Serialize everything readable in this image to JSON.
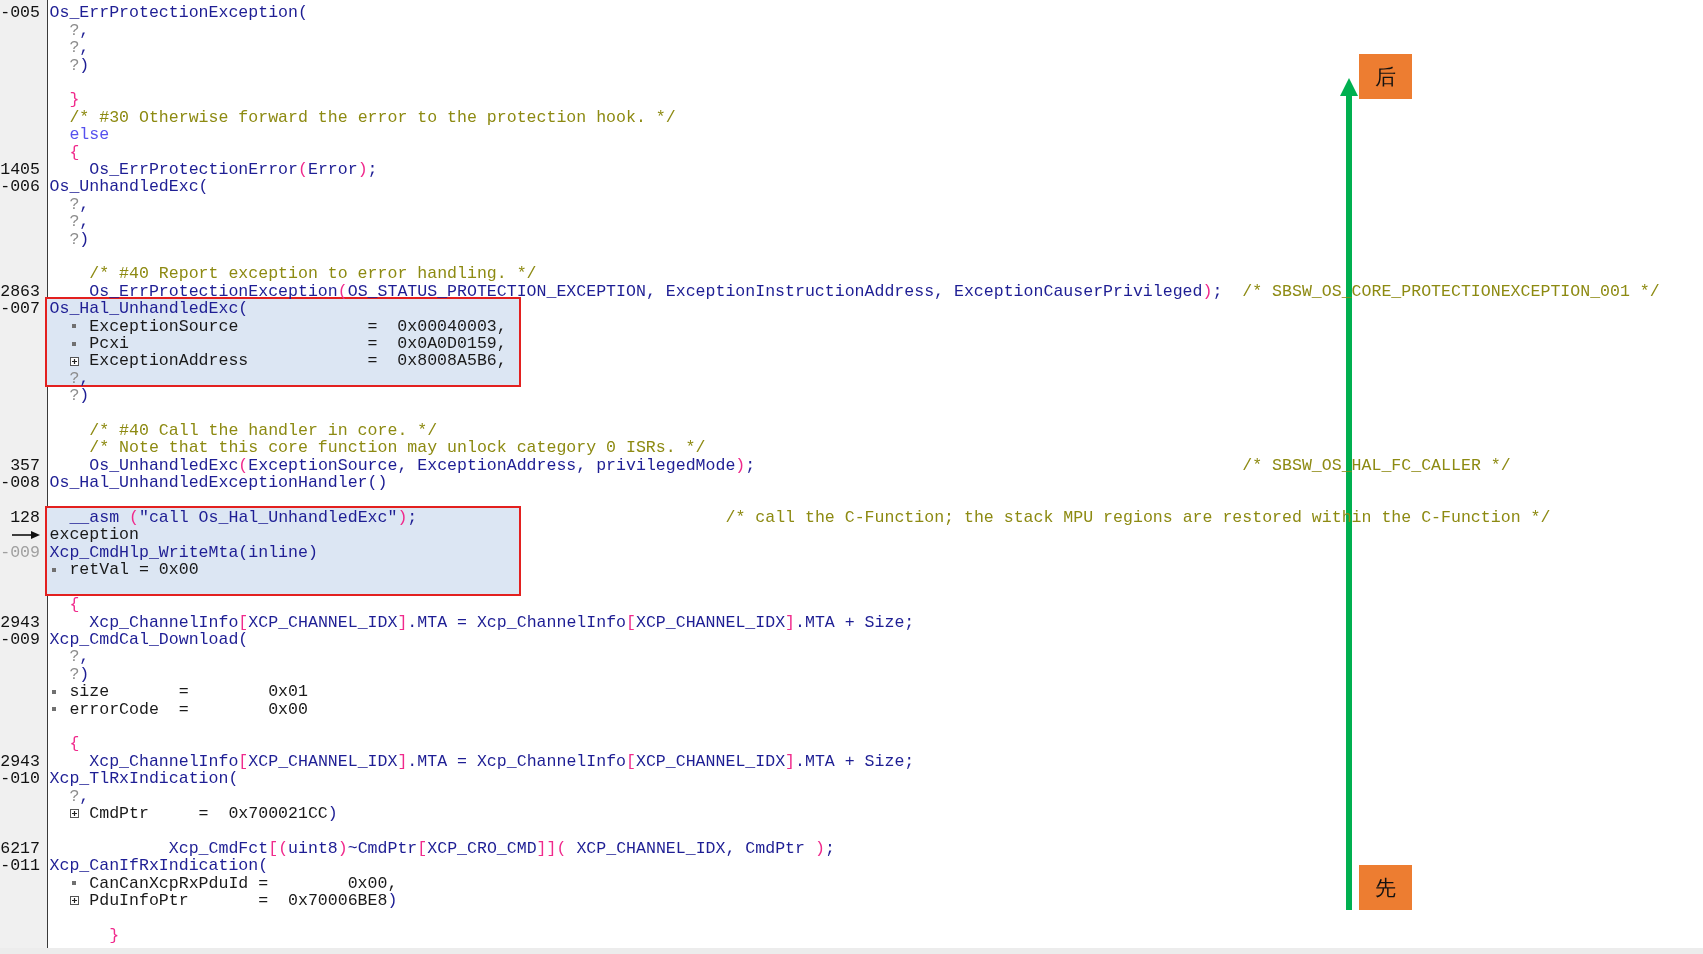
{
  "lines": [
    {
      "kind": "frame",
      "boxed": false,
      "current": false,
      "number": {
        "text": "-005",
        "dimmed": false
      },
      "parts": [
        {
          "kind": "frame",
          "tokens": [
            {
              "kind": "name",
              "text": "Os_ErrProtectionException("
            }
          ]
        }
      ]
    },
    {
      "kind": "arg",
      "boxed": false,
      "current": false,
      "parts": [
        {
          "kind": "argument",
          "tokens": [
            {
              "kind": "unknown",
              "text": "?"
            },
            {
              "kind": "name",
              "text": ","
            }
          ]
        }
      ]
    },
    {
      "kind": "arg",
      "boxed": false,
      "current": false,
      "parts": [
        {
          "kind": "argument",
          "tokens": [
            {
              "kind": "unknown",
              "text": "?"
            },
            {
              "kind": "name",
              "text": ","
            }
          ]
        }
      ]
    },
    {
      "kind": "arg",
      "boxed": false,
      "current": false,
      "parts": [
        {
          "kind": "argument",
          "tokens": [
            {
              "kind": "unknown",
              "text": "?"
            },
            {
              "kind": "name",
              "text": ")"
            }
          ]
        }
      ]
    },
    {
      "kind": "blank",
      "boxed": false,
      "current": false
    },
    {
      "kind": "code",
      "boxed": false,
      "current": false,
      "parts": [
        {
          "kind": "source",
          "tokens": [
            {
              "kind": "punct",
              "text": "  }"
            }
          ]
        }
      ]
    },
    {
      "kind": "code",
      "boxed": false,
      "current": false,
      "parts": [
        {
          "kind": "comment",
          "tokens": [
            {
              "kind": "comment",
              "text": "  /* #30 Otherwise forward the error to the protection hook. */"
            }
          ]
        }
      ]
    },
    {
      "kind": "code",
      "boxed": false,
      "current": false,
      "parts": [
        {
          "kind": "source",
          "tokens": [
            {
              "kind": "keyword",
              "text": "  else"
            }
          ]
        }
      ]
    },
    {
      "kind": "code",
      "boxed": false,
      "current": false,
      "parts": [
        {
          "kind": "source",
          "tokens": [
            {
              "kind": "punct",
              "text": "  {"
            }
          ]
        }
      ]
    },
    {
      "kind": "code",
      "boxed": false,
      "current": false,
      "number": {
        "text": "1405",
        "dimmed": false
      },
      "parts": [
        {
          "kind": "source",
          "tokens": [
            {
              "kind": "name",
              "text": "    Os_ErrProtectionError"
            },
            {
              "kind": "punct",
              "text": "("
            },
            {
              "kind": "name",
              "text": "Error"
            },
            {
              "kind": "punct",
              "text": ")"
            },
            {
              "kind": "name",
              "text": ";"
            }
          ]
        }
      ]
    },
    {
      "kind": "frame",
      "boxed": false,
      "current": false,
      "number": {
        "text": "-006",
        "dimmed": false
      },
      "parts": [
        {
          "kind": "frame",
          "tokens": [
            {
              "kind": "name",
              "text": "Os_UnhandledExc("
            }
          ]
        }
      ]
    },
    {
      "kind": "arg",
      "boxed": false,
      "current": false,
      "parts": [
        {
          "kind": "argument",
          "tokens": [
            {
              "kind": "unknown",
              "text": "?"
            },
            {
              "kind": "name",
              "text": ","
            }
          ]
        }
      ]
    },
    {
      "kind": "arg",
      "boxed": false,
      "current": false,
      "parts": [
        {
          "kind": "argument",
          "tokens": [
            {
              "kind": "unknown",
              "text": "?"
            },
            {
              "kind": "name",
              "text": ","
            }
          ]
        }
      ]
    },
    {
      "kind": "arg",
      "boxed": false,
      "current": false,
      "parts": [
        {
          "kind": "argument",
          "tokens": [
            {
              "kind": "unknown",
              "text": "?"
            },
            {
              "kind": "name",
              "text": ")"
            }
          ]
        }
      ]
    },
    {
      "kind": "blank",
      "boxed": false,
      "current": false
    },
    {
      "kind": "code",
      "boxed": false,
      "current": false,
      "parts": [
        {
          "kind": "comment",
          "tokens": [
            {
              "kind": "comment",
              "text": "    /* #40 Report exception to error handling. */"
            }
          ]
        }
      ]
    },
    {
      "kind": "code",
      "boxed": false,
      "current": false,
      "number": {
        "text": "2863",
        "dimmed": false
      },
      "parts": [
        {
          "kind": "source",
          "tokens": [
            {
              "kind": "name",
              "text": "    Os_ErrProtectionException"
            },
            {
              "kind": "punct",
              "text": "("
            },
            {
              "kind": "name",
              "text": "OS_STATUS_PROTECTION_EXCEPTION, ExceptionInstructionAddress, ExceptionCauserPrivileged"
            },
            {
              "kind": "punct",
              "text": ")"
            },
            {
              "kind": "name",
              "text": ";"
            }
          ]
        },
        {
          "kind": "comment",
          "tokens": [
            {
              "kind": "comment",
              "text": "  /* SBSW_OS_CORE_PROTECTIONEXCEPTION_001 */"
            }
          ]
        }
      ]
    },
    {
      "kind": "frame",
      "boxed": true,
      "current": false,
      "number": {
        "text": "-007",
        "dimmed": false
      },
      "parts": [
        {
          "kind": "frame",
          "tokens": [
            {
              "kind": "name",
              "text": "Os_Hal_UnhandledExc("
            }
          ]
        }
      ]
    },
    {
      "kind": "arg",
      "boxed": true,
      "current": false,
      "parts": [
        {
          "kind": "bullet"
        },
        {
          "kind": "argument",
          "tokens": [
            {
              "kind": "plain",
              "text": "ExceptionSource             =  0x00040003,"
            }
          ]
        }
      ]
    },
    {
      "kind": "arg",
      "boxed": true,
      "current": false,
      "parts": [
        {
          "kind": "bullet"
        },
        {
          "kind": "argument",
          "tokens": [
            {
              "kind": "plain",
              "text": "Pcxi                        =  0x0A0D0159,"
            }
          ]
        }
      ]
    },
    {
      "kind": "arg",
      "boxed": true,
      "current": false,
      "parts": [
        {
          "kind": "expand"
        },
        {
          "kind": "argument",
          "tokens": [
            {
              "kind": "plain",
              "text": "ExceptionAddress            =  0x8008A5B6,"
            }
          ]
        }
      ]
    },
    {
      "kind": "arg",
      "boxed": true,
      "current": false,
      "parts": [
        {
          "kind": "argument",
          "tokens": [
            {
              "kind": "unknown",
              "text": "?"
            },
            {
              "kind": "name",
              "text": ","
            }
          ]
        }
      ]
    },
    {
      "kind": "arg",
      "boxed": false,
      "current": false,
      "parts": [
        {
          "kind": "argument",
          "tokens": [
            {
              "kind": "unknown",
              "text": "?"
            },
            {
              "kind": "name",
              "text": ")"
            }
          ]
        }
      ]
    },
    {
      "kind": "blank",
      "boxed": false,
      "current": false
    },
    {
      "kind": "code",
      "boxed": false,
      "current": false,
      "parts": [
        {
          "kind": "comment",
          "tokens": [
            {
              "kind": "comment",
              "text": "    /* #40 Call the handler in core. */"
            }
          ]
        }
      ]
    },
    {
      "kind": "code",
      "boxed": false,
      "current": false,
      "parts": [
        {
          "kind": "comment",
          "tokens": [
            {
              "kind": "comment",
              "text": "    /* Note that this core function may unlock category 0 ISRs. */"
            }
          ]
        }
      ]
    },
    {
      "kind": "code",
      "boxed": false,
      "current": false,
      "number": {
        "text": "357",
        "dimmed": false
      },
      "parts": [
        {
          "kind": "source",
          "tokens": [
            {
              "kind": "name",
              "text": "    Os_UnhandledExc"
            },
            {
              "kind": "punct",
              "text": "("
            },
            {
              "kind": "name",
              "text": "ExceptionSource, ExceptionAddress, privilegedMode"
            },
            {
              "kind": "punct",
              "text": ")"
            },
            {
              "kind": "name",
              "text": ";"
            }
          ]
        },
        {
          "kind": "comment",
          "tokens": [
            {
              "kind": "comment",
              "text": "                                                 /* SBSW_OS_HAL_FC_CALLER */"
            }
          ]
        }
      ]
    },
    {
      "kind": "frame",
      "boxed": false,
      "current": false,
      "number": {
        "text": "-008",
        "dimmed": false
      },
      "parts": [
        {
          "kind": "frame",
          "tokens": [
            {
              "kind": "name",
              "text": "Os_Hal_UnhandledExceptionHandler()"
            }
          ]
        }
      ]
    },
    {
      "kind": "blank",
      "boxed": false,
      "current": false
    },
    {
      "kind": "code",
      "boxed": true,
      "current": false,
      "number": {
        "text": "128",
        "dimmed": false
      },
      "parts": [
        {
          "kind": "source",
          "tokens": [
            {
              "kind": "name",
              "text": "  __asm "
            },
            {
              "kind": "punct",
              "text": "("
            },
            {
              "kind": "name",
              "text": "\"call Os_Hal_UnhandledExc\""
            },
            {
              "kind": "punct",
              "text": ")"
            },
            {
              "kind": "name",
              "text": ";"
            }
          ]
        },
        {
          "kind": "comment",
          "tokens": [
            {
              "kind": "comment",
              "text": "                               /* call the C-Function; the stack MPU regions are restored within the C-Function */"
            }
          ]
        }
      ]
    },
    {
      "kind": "frame",
      "boxed": true,
      "current": true,
      "parts": [
        {
          "kind": "frame",
          "tokens": [
            {
              "kind": "plain",
              "text": "exception"
            }
          ]
        }
      ]
    },
    {
      "kind": "frame",
      "boxed": true,
      "current": false,
      "number": {
        "text": "-009",
        "dimmed": true
      },
      "parts": [
        {
          "kind": "frame",
          "tokens": [
            {
              "kind": "name",
              "text": "Xcp_CmdHlp_WriteMta(inline)"
            }
          ]
        }
      ]
    },
    {
      "kind": "local",
      "boxed": true,
      "current": false,
      "parts": [
        {
          "kind": "bullet"
        },
        {
          "kind": "local",
          "tokens": [
            {
              "kind": "plain",
              "text": "retVal = 0x00"
            }
          ]
        }
      ]
    },
    {
      "kind": "blank",
      "boxed": true,
      "current": false
    },
    {
      "kind": "code",
      "boxed": false,
      "current": false,
      "parts": [
        {
          "kind": "source",
          "tokens": [
            {
              "kind": "punct",
              "text": "  {"
            }
          ]
        }
      ]
    },
    {
      "kind": "code",
      "boxed": false,
      "current": false,
      "number": {
        "text": "2943",
        "dimmed": false
      },
      "parts": [
        {
          "kind": "source",
          "tokens": [
            {
              "kind": "name",
              "text": "    Xcp_ChannelInfo"
            },
            {
              "kind": "punct",
              "text": "["
            },
            {
              "kind": "name",
              "text": "XCP_CHANNEL_IDX"
            },
            {
              "kind": "punct",
              "text": "]"
            },
            {
              "kind": "name",
              "text": ".MTA = Xcp_ChannelInfo"
            },
            {
              "kind": "punct",
              "text": "["
            },
            {
              "kind": "name",
              "text": "XCP_CHANNEL_IDX"
            },
            {
              "kind": "punct",
              "text": "]"
            },
            {
              "kind": "name",
              "text": ".MTA + Size;"
            }
          ]
        }
      ]
    },
    {
      "kind": "frame",
      "boxed": false,
      "current": false,
      "number": {
        "text": "-009",
        "dimmed": false
      },
      "parts": [
        {
          "kind": "frame",
          "tokens": [
            {
              "kind": "name",
              "text": "Xcp_CmdCal_Download("
            }
          ]
        }
      ]
    },
    {
      "kind": "arg",
      "boxed": false,
      "current": false,
      "parts": [
        {
          "kind": "argument",
          "tokens": [
            {
              "kind": "unknown",
              "text": "?"
            },
            {
              "kind": "name",
              "text": ","
            }
          ]
        }
      ]
    },
    {
      "kind": "arg",
      "boxed": false,
      "current": false,
      "parts": [
        {
          "kind": "argument",
          "tokens": [
            {
              "kind": "unknown",
              "text": "?"
            },
            {
              "kind": "name",
              "text": ")"
            }
          ]
        }
      ]
    },
    {
      "kind": "local",
      "boxed": false,
      "current": false,
      "parts": [
        {
          "kind": "bullet"
        },
        {
          "kind": "local",
          "tokens": [
            {
              "kind": "plain",
              "text": "size       =        0x01"
            }
          ]
        }
      ]
    },
    {
      "kind": "local",
      "boxed": false,
      "current": false,
      "parts": [
        {
          "kind": "bullet"
        },
        {
          "kind": "local",
          "tokens": [
            {
              "kind": "plain",
              "text": "errorCode  =        0x00"
            }
          ]
        }
      ]
    },
    {
      "kind": "blank",
      "boxed": false,
      "current": false
    },
    {
      "kind": "code",
      "boxed": false,
      "current": false,
      "parts": [
        {
          "kind": "source",
          "tokens": [
            {
              "kind": "punct",
              "text": "  {"
            }
          ]
        }
      ]
    },
    {
      "kind": "code",
      "boxed": false,
      "current": false,
      "number": {
        "text": "2943",
        "dimmed": false
      },
      "parts": [
        {
          "kind": "source",
          "tokens": [
            {
              "kind": "name",
              "text": "    Xcp_ChannelInfo"
            },
            {
              "kind": "punct",
              "text": "["
            },
            {
              "kind": "name",
              "text": "XCP_CHANNEL_IDX"
            },
            {
              "kind": "punct",
              "text": "]"
            },
            {
              "kind": "name",
              "text": ".MTA = Xcp_ChannelInfo"
            },
            {
              "kind": "punct",
              "text": "["
            },
            {
              "kind": "name",
              "text": "XCP_CHANNEL_IDX"
            },
            {
              "kind": "punct",
              "text": "]"
            },
            {
              "kind": "name",
              "text": ".MTA + Size;"
            }
          ]
        }
      ]
    },
    {
      "kind": "frame",
      "boxed": false,
      "current": false,
      "number": {
        "text": "-010",
        "dimmed": false
      },
      "parts": [
        {
          "kind": "frame",
          "tokens": [
            {
              "kind": "name",
              "text": "Xcp_TlRxIndication("
            }
          ]
        }
      ]
    },
    {
      "kind": "arg",
      "boxed": false,
      "current": false,
      "parts": [
        {
          "kind": "argument",
          "tokens": [
            {
              "kind": "unknown",
              "text": "?"
            },
            {
              "kind": "name",
              "text": ","
            }
          ]
        }
      ]
    },
    {
      "kind": "arg",
      "boxed": false,
      "current": false,
      "parts": [
        {
          "kind": "expand"
        },
        {
          "kind": "argument",
          "tokens": [
            {
              "kind": "plain",
              "text": "CmdPtr     =  0x700021CC"
            },
            {
              "kind": "name",
              "text": ")"
            }
          ]
        }
      ]
    },
    {
      "kind": "blank",
      "boxed": false,
      "current": false
    },
    {
      "kind": "code",
      "boxed": false,
      "current": false,
      "number": {
        "text": "6217",
        "dimmed": false
      },
      "parts": [
        {
          "kind": "source",
          "tokens": [
            {
              "kind": "name",
              "text": "            Xcp_CmdFct"
            },
            {
              "kind": "punct",
              "text": "[("
            },
            {
              "kind": "name",
              "text": "uint8"
            },
            {
              "kind": "punct",
              "text": ")"
            },
            {
              "kind": "name",
              "text": "~CmdPtr"
            },
            {
              "kind": "punct",
              "text": "["
            },
            {
              "kind": "name",
              "text": "XCP_CRO_CMD"
            },
            {
              "kind": "punct",
              "text": "]]("
            },
            {
              "kind": "name",
              "text": " XCP_CHANNEL_IDX, CmdPtr "
            },
            {
              "kind": "punct",
              "text": ")"
            },
            {
              "kind": "name",
              "text": ";"
            }
          ]
        }
      ]
    },
    {
      "kind": "frame",
      "boxed": false,
      "current": false,
      "number": {
        "text": "-011",
        "dimmed": false
      },
      "parts": [
        {
          "kind": "frame",
          "tokens": [
            {
              "kind": "name",
              "text": "Xcp_CanIfRxIndication("
            }
          ]
        }
      ]
    },
    {
      "kind": "arg",
      "boxed": false,
      "current": false,
      "parts": [
        {
          "kind": "bullet"
        },
        {
          "kind": "argument",
          "tokens": [
            {
              "kind": "plain",
              "text": "CanCanXcpRxPduId =        0x00,"
            }
          ]
        }
      ]
    },
    {
      "kind": "arg",
      "boxed": false,
      "current": false,
      "parts": [
        {
          "kind": "expand"
        },
        {
          "kind": "argument",
          "tokens": [
            {
              "kind": "plain",
              "text": "PduInfoPtr       =  0x70006BE8"
            },
            {
              "kind": "name",
              "text": ")"
            }
          ]
        }
      ]
    },
    {
      "kind": "blank",
      "boxed": false,
      "current": false
    },
    {
      "kind": "code",
      "boxed": false,
      "current": false,
      "parts": [
        {
          "kind": "source",
          "tokens": [
            {
              "kind": "punct",
              "text": "      }"
            }
          ]
        }
      ]
    }
  ],
  "annotation": {
    "top_tag": "后",
    "bottom_tag": "先"
  }
}
